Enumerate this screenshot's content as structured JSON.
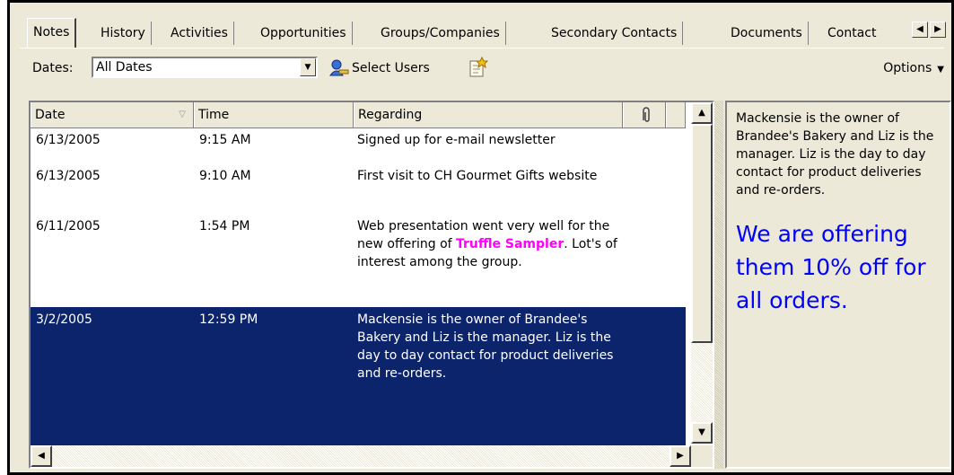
{
  "tabs": [
    {
      "label": "Notes",
      "active": true
    },
    {
      "label": "History"
    },
    {
      "label": "Activities"
    },
    {
      "label": "Opportunities"
    },
    {
      "label": "Groups/Companies"
    },
    {
      "label": "Secondary Contacts"
    },
    {
      "label": "Documents"
    },
    {
      "label": "Contact"
    }
  ],
  "toolbar": {
    "dates_label": "Dates:",
    "dates_value": "All Dates",
    "select_users_label": "Select Users",
    "options_label": "Options"
  },
  "grid": {
    "columns": [
      "Date",
      "Time",
      "Regarding"
    ],
    "rows": [
      {
        "date": "6/13/2005",
        "time": "9:15 AM",
        "regarding": "Signed up for e-mail newsletter"
      },
      {
        "date": "6/13/2005",
        "time": "9:10 AM",
        "regarding": "First visit to CH Gourmet Gifts website"
      },
      {
        "date": "6/11/2005",
        "time": "1:54 PM",
        "regarding_pre": "Web  presentation went very well for the new offering of ",
        "regarding_highlight": "Truffle Sampler",
        "regarding_post": ". Lot's of interest among the group."
      },
      {
        "date": "3/2/2005",
        "time": "12:59 PM",
        "regarding": "Mackensie is the owner of Brandee's Bakery and Liz is the manager. Liz is the day to day contact for product deliveries and re-orders.",
        "selected": true
      }
    ]
  },
  "preview": {
    "text": "Mackensie is the owner of Brandee's Bakery and Liz is the manager. Liz is the day to day contact for product deliveries and re-orders.",
    "offer": "We are offering them 10% off for all orders."
  },
  "colors": {
    "selection": "#0c246b",
    "highlight": "#ff00ff",
    "offer": "#0000ff",
    "chrome": "#ece9d8"
  },
  "icons": [
    "users-icon",
    "note-icon",
    "attachment-icon",
    "chevron-down-icon",
    "scroll-left-icon",
    "scroll-right-icon",
    "scroll-up-icon",
    "scroll-down-icon"
  ]
}
